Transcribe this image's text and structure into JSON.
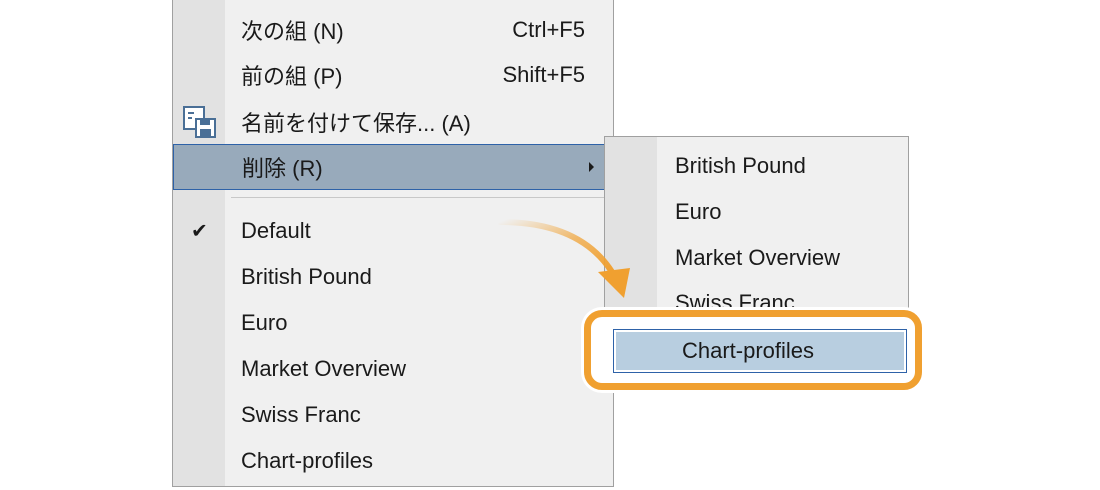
{
  "menu": {
    "items": [
      {
        "label": "次の組 (N)",
        "shortcut": "Ctrl+F5"
      },
      {
        "label": "前の組 (P)",
        "shortcut": "Shift+F5"
      },
      {
        "label": "名前を付けて保存... (A)",
        "icon": "save-icon"
      },
      {
        "label": "削除 (R)",
        "submenu": true,
        "highlighted": true
      },
      {
        "label": "Default",
        "checked": true
      },
      {
        "label": "British Pound"
      },
      {
        "label": "Euro"
      },
      {
        "label": "Market Overview"
      },
      {
        "label": "Swiss Franc"
      },
      {
        "label": "Chart-profiles"
      }
    ]
  },
  "submenu": {
    "items": [
      {
        "label": "British Pound"
      },
      {
        "label": "Euro"
      },
      {
        "label": "Market Overview"
      },
      {
        "label": "Swiss Franc"
      },
      {
        "label": "Chart-profiles",
        "highlighted": true
      }
    ]
  },
  "colors": {
    "highlight_border": "#f0a030",
    "selection_fill": "#98aabb",
    "selection_border": "#2e62a8",
    "arrow": "#f0a030"
  }
}
